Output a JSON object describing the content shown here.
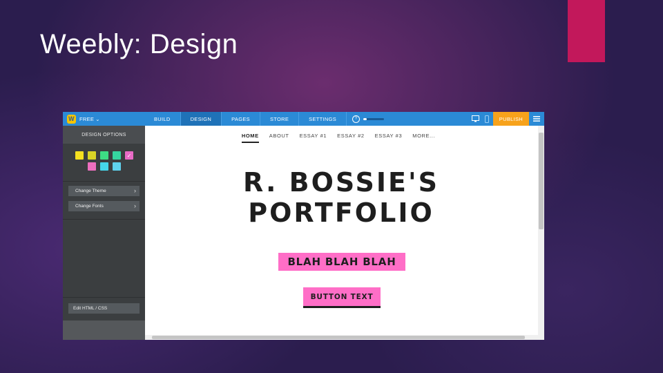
{
  "slide": {
    "title": "Weebly: Design",
    "accent_color": "#c2185b"
  },
  "topbar": {
    "logo_letter": "W",
    "plan_label": "FREE",
    "tabs": [
      {
        "label": "BUILD",
        "active": false
      },
      {
        "label": "DESIGN",
        "active": true
      },
      {
        "label": "PAGES",
        "active": false
      },
      {
        "label": "STORE",
        "active": false
      },
      {
        "label": "SETTINGS",
        "active": false
      }
    ],
    "help_icon": "?",
    "progress_fraction": 0.15,
    "publish_label": "PUBLISH",
    "bar_color": "#2b8ad6",
    "publish_color": "#f7a21b"
  },
  "sidebar": {
    "heading": "DESIGN OPTIONS",
    "swatches": [
      {
        "color": "#f5e020",
        "selected": false
      },
      {
        "color": "#d8d426",
        "selected": false
      },
      {
        "color": "#3ddc84",
        "selected": false
      },
      {
        "color": "#35d6a0",
        "selected": false
      },
      {
        "color": "#e86bc6",
        "selected": true
      },
      {
        "color": "#ee6fbe",
        "selected": false
      },
      {
        "color": "#45d6ea",
        "selected": false
      },
      {
        "color": "#5fd2ee",
        "selected": false
      }
    ],
    "buttons": [
      {
        "label": "Change Theme"
      },
      {
        "label": "Change Fonts"
      }
    ],
    "edit_html_label": "Edit HTML / CSS"
  },
  "site": {
    "nav": [
      "HOME",
      "ABOUT",
      "ESSAY #1",
      "ESSAY #2",
      "ESSAY #3",
      "MORE..."
    ],
    "active_nav": "HOME",
    "hero_line1": "R. BOSSIE'S",
    "hero_line2": "PORTFOLIO",
    "highlight_text": "BLAH BLAH BLAH",
    "button_text": "BUTTON TEXT",
    "pink": "#ff6ec7"
  }
}
